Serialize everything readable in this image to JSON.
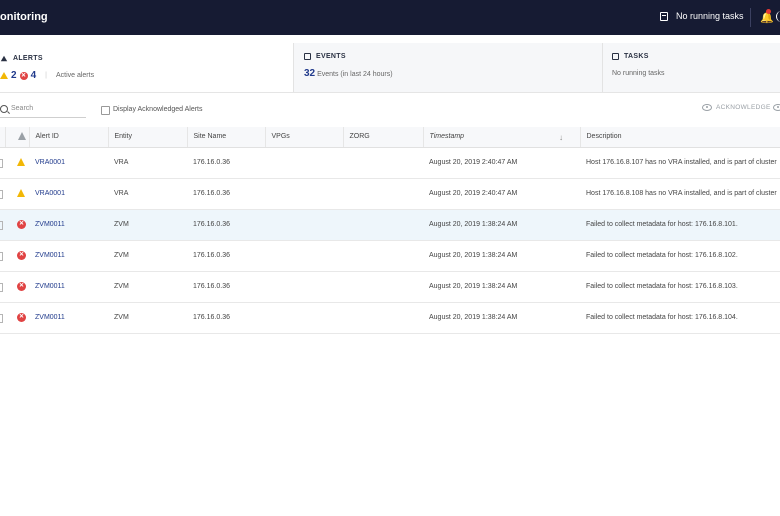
{
  "app": {
    "title": "onitoring"
  },
  "topbar": {
    "tasks_label": "No running tasks",
    "tasks_icon": "clipboard-icon",
    "bell_icon": "bell-icon"
  },
  "summary": {
    "alerts": {
      "title": "ALERTS",
      "warning_count": "2",
      "error_count": "4",
      "subtitle": "Active alerts"
    },
    "events": {
      "title": "EVENTS",
      "count": "32",
      "subtitle": "Events (in last 24 hours)"
    },
    "tasks": {
      "title": "TASKS",
      "subtitle": "No running tasks"
    }
  },
  "toolbar": {
    "search_placeholder": "Search",
    "display_ack_label": "Display Acknowledged Alerts",
    "acknowledge_label": "ACKNOWLEDGE"
  },
  "table": {
    "headers": [
      "Alert ID",
      "Entity",
      "Site Name",
      "VPGs",
      "ZORG",
      "Timestamp",
      "Description"
    ],
    "rows": [
      {
        "severity": "warning",
        "alert_id": "VRA0001",
        "entity": "VRA",
        "site": "176.16.0.36",
        "vpgs": "",
        "zorg": "",
        "timestamp": "August 20, 2019 2:40:47 AM",
        "description": "Host 176.16.8.107 has no VRA installed, and is part of cluster"
      },
      {
        "severity": "warning",
        "alert_id": "VRA0001",
        "entity": "VRA",
        "site": "176.16.0.36",
        "vpgs": "",
        "zorg": "",
        "timestamp": "August 20, 2019 2:40:47 AM",
        "description": "Host 176.16.8.108 has no VRA installed, and is part of cluster"
      },
      {
        "severity": "error",
        "alert_id": "ZVM0011",
        "entity": "ZVM",
        "site": "176.16.0.36",
        "vpgs": "",
        "zorg": "",
        "timestamp": "August 20, 2019 1:38:24 AM",
        "description": "Failed to collect metadata for host: 176.16.8.101."
      },
      {
        "severity": "error",
        "alert_id": "ZVM0011",
        "entity": "ZVM",
        "site": "176.16.0.36",
        "vpgs": "",
        "zorg": "",
        "timestamp": "August 20, 2019 1:38:24 AM",
        "description": "Failed to collect metadata for host: 176.16.8.102."
      },
      {
        "severity": "error",
        "alert_id": "ZVM0011",
        "entity": "ZVM",
        "site": "176.16.0.36",
        "vpgs": "",
        "zorg": "",
        "timestamp": "August 20, 2019 1:38:24 AM",
        "description": "Failed to collect metadata for host: 176.16.8.103."
      },
      {
        "severity": "error",
        "alert_id": "ZVM0011",
        "entity": "ZVM",
        "site": "176.16.0.36",
        "vpgs": "",
        "zorg": "",
        "timestamp": "August 20, 2019 1:38:24 AM",
        "description": "Failed to collect metadata for host: 176.16.8.104."
      }
    ]
  },
  "colors": {
    "topbar": "#161b33",
    "accent": "#203a8c",
    "warning": "#f2b705",
    "error": "#e04343",
    "selected_row": "#eef6fb"
  }
}
